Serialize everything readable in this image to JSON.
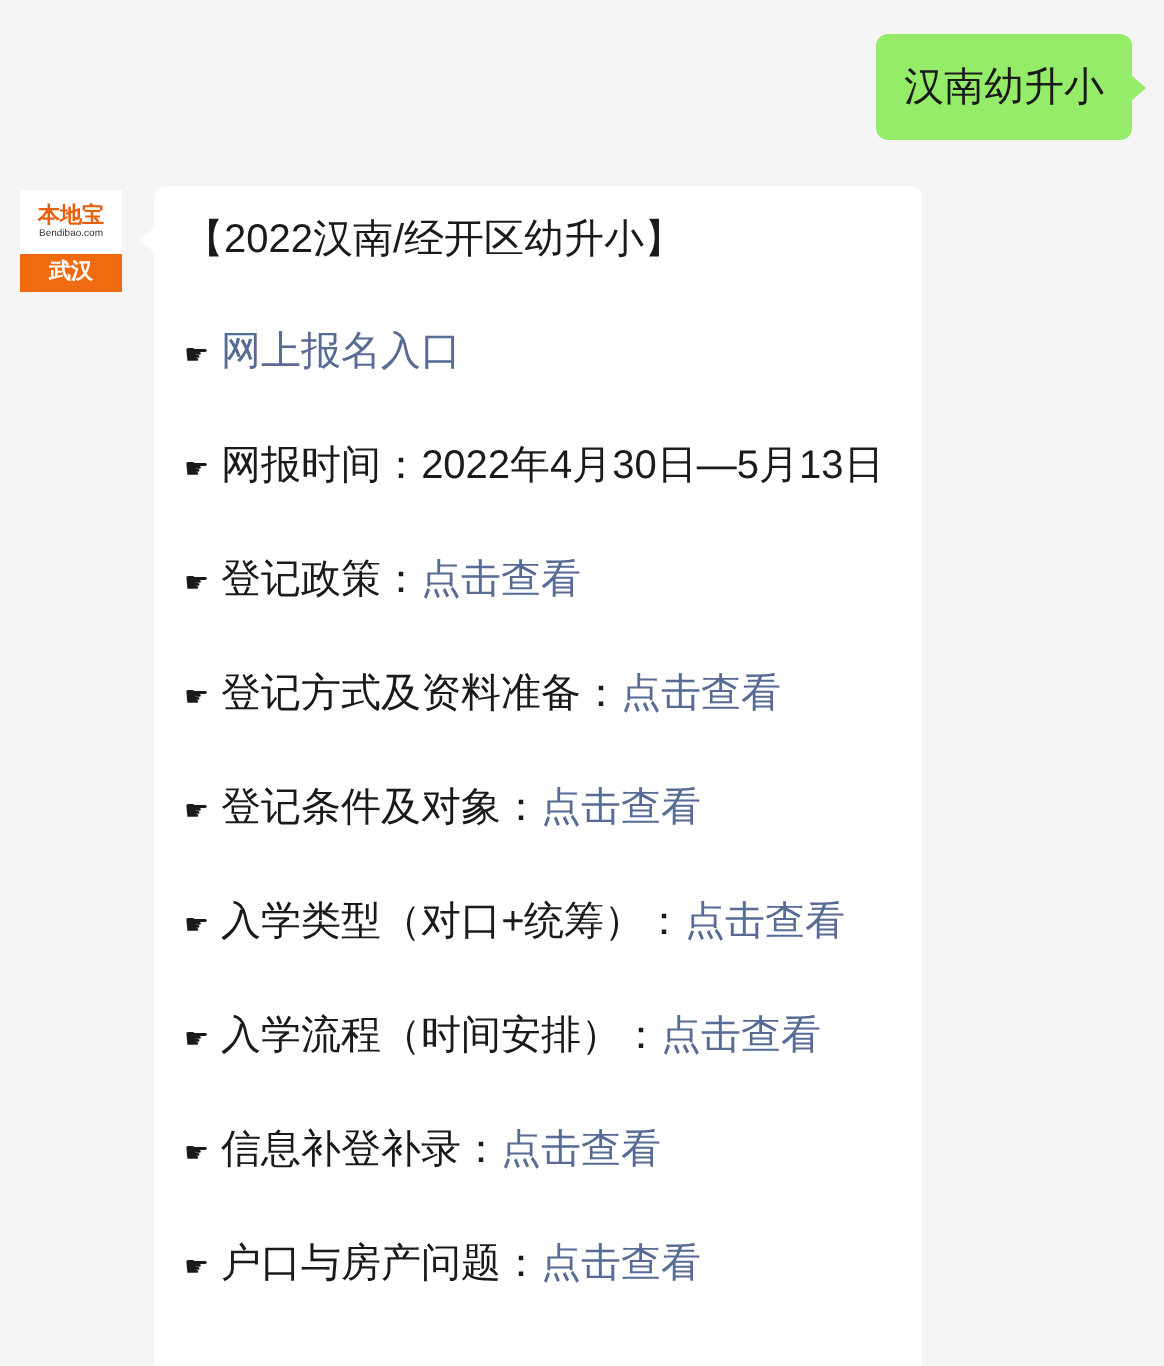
{
  "outgoing": {
    "text": "汉南幼升小"
  },
  "incoming": {
    "avatar": {
      "brand": "本地宝",
      "site": "Bendibao.com",
      "city": "武汉"
    },
    "title": "【2022汉南/经开区幼升小】",
    "items": [
      {
        "pointer": "☛",
        "link": "网上报名入口"
      },
      {
        "pointer": "☛",
        "label": "网报时间：2022年4月30日—5月13日"
      },
      {
        "pointer": "☛",
        "label": "登记政策：",
        "link": "点击查看"
      },
      {
        "pointer": "☛",
        "label": "登记方式及资料准备：",
        "link": "点击查看"
      },
      {
        "pointer": "☛",
        "label": "登记条件及对象：",
        "link": "点击查看"
      },
      {
        "pointer": "☛",
        "label": "入学类型（对口+统筹）：",
        "link": "点击查看"
      },
      {
        "pointer": "☛",
        "label": "入学流程（时间安排）：",
        "link": "点击查看"
      },
      {
        "pointer": "☛",
        "label": "信息补登补录：",
        "link": "点击查看"
      },
      {
        "pointer": "☛",
        "label": "户口与房产问题：",
        "link": "点击查看"
      }
    ]
  }
}
